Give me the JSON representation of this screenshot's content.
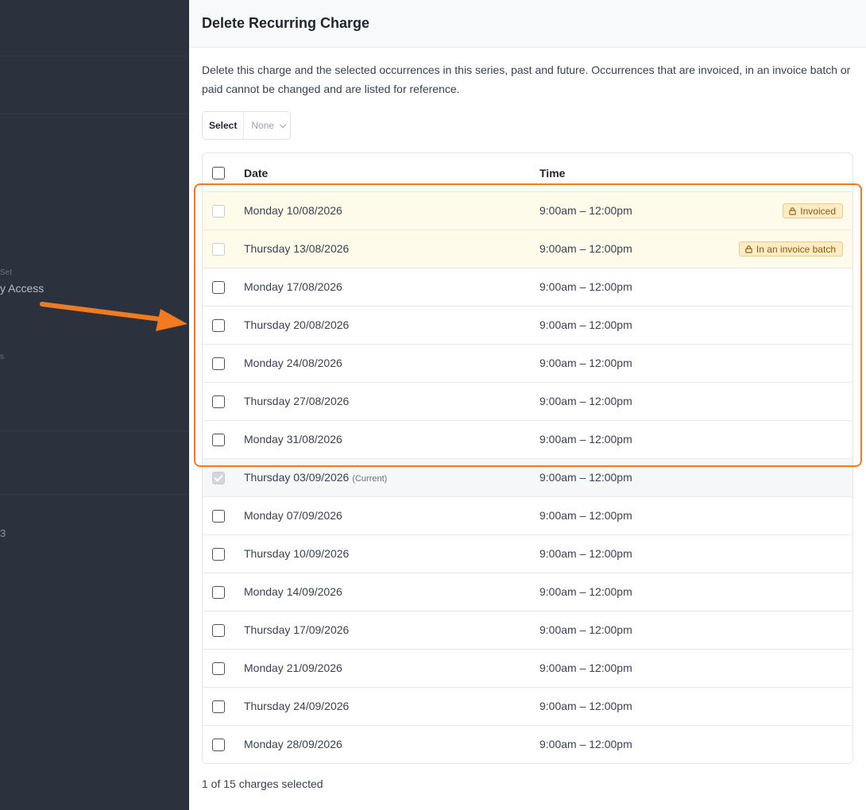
{
  "background": {
    "small_label": "Set",
    "access_label": "y Access",
    "tiny_1": "s",
    "tiny_2": "3"
  },
  "dialog": {
    "title": "Delete Recurring Charge",
    "description": "Delete this charge and the selected occurrences in this series, past and future. Occurrences that are invoiced, in an invoice batch or paid cannot be changed and are listed for reference.",
    "select": {
      "label": "Select",
      "value": "None"
    },
    "table": {
      "headers": {
        "date": "Date",
        "time": "Time"
      },
      "rows": [
        {
          "date": "Monday 10/08/2026",
          "time": "9:00am – 12:00pm",
          "badge": "Invoiced"
        },
        {
          "date": "Thursday 13/08/2026",
          "time": "9:00am – 12:00pm",
          "badge": "In an invoice batch"
        },
        {
          "date": "Monday 17/08/2026",
          "time": "9:00am – 12:00pm"
        },
        {
          "date": "Thursday 20/08/2026",
          "time": "9:00am – 12:00pm"
        },
        {
          "date": "Monday 24/08/2026",
          "time": "9:00am – 12:00pm"
        },
        {
          "date": "Thursday 27/08/2026",
          "time": "9:00am – 12:00pm"
        },
        {
          "date": "Monday 31/08/2026",
          "time": "9:00am – 12:00pm"
        },
        {
          "date": "Thursday 03/09/2026",
          "time": "9:00am – 12:00pm",
          "current_label": "(Current)"
        },
        {
          "date": "Monday 07/09/2026",
          "time": "9:00am – 12:00pm"
        },
        {
          "date": "Thursday 10/09/2026",
          "time": "9:00am – 12:00pm"
        },
        {
          "date": "Monday 14/09/2026",
          "time": "9:00am – 12:00pm"
        },
        {
          "date": "Thursday 17/09/2026",
          "time": "9:00am – 12:00pm"
        },
        {
          "date": "Monday 21/09/2026",
          "time": "9:00am – 12:00pm"
        },
        {
          "date": "Thursday 24/09/2026",
          "time": "9:00am – 12:00pm"
        },
        {
          "date": "Monday 28/09/2026",
          "time": "9:00am – 12:00pm"
        }
      ]
    },
    "footer": "1 of 15 charges selected"
  },
  "colors": {
    "annotation": "#f47a20",
    "locked_row": "#fefbea",
    "badge_bg": "#fdecc4"
  }
}
